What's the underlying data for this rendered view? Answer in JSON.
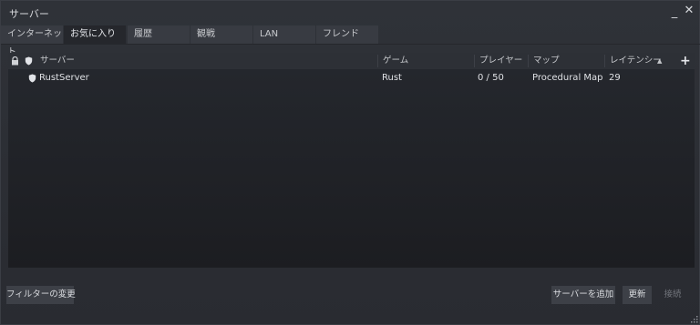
{
  "window": {
    "title": "サーバー",
    "minimize_label": "_",
    "close_label": "✕"
  },
  "tabs": [
    {
      "label": "インターネット",
      "active": false
    },
    {
      "label": "お気に入り",
      "active": true
    },
    {
      "label": "履歴",
      "active": false
    },
    {
      "label": "観戦",
      "active": false
    },
    {
      "label": "LAN",
      "active": false
    },
    {
      "label": "フレンド",
      "active": false
    }
  ],
  "table": {
    "header_icons": [
      "lock-icon",
      "shield-icon"
    ],
    "columns": {
      "server": "サーバー",
      "game": "ゲーム",
      "players": "プレイヤー",
      "map": "マップ",
      "latency": "レイテンシー",
      "sort_indicator": "▲",
      "add": "+"
    },
    "rows": [
      {
        "icon": "shield-icon",
        "server": "RustServer",
        "game": "Rust",
        "players": "0 / 50",
        "map": "Procedural Map",
        "latency": "29"
      }
    ]
  },
  "buttons": {
    "change_filters": "フィルターの変更",
    "add_server": "サーバーを追加",
    "refresh": "更新",
    "connect": "接続"
  },
  "colors": {
    "background": "#2f3238",
    "panel": "#1f2025",
    "tab": "#383b42",
    "tab_active": "#25272c",
    "text": "#dfe1e5"
  }
}
